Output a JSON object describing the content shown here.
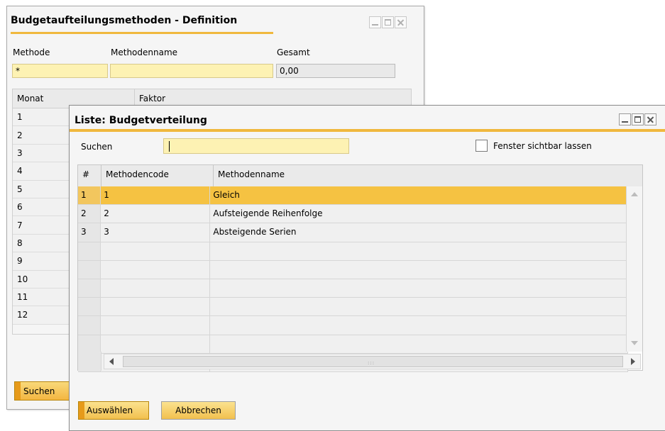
{
  "back_window": {
    "title": "Budgetaufteilungsmethoden - Definition",
    "fields": {
      "method_label": "Methode",
      "method_value": "*",
      "method_name_label": "Methodenname",
      "method_name_value": "",
      "total_label": "Gesamt",
      "total_value": "0,00"
    },
    "table": {
      "columns": [
        "Monat",
        "Faktor"
      ],
      "rows": [
        "1",
        "2",
        "3",
        "4",
        "5",
        "6",
        "7",
        "8",
        "9",
        "10",
        "11",
        "12"
      ]
    },
    "search_button": "Suchen"
  },
  "dialog": {
    "title": "Liste: Budgetverteilung",
    "search_label": "Suchen",
    "search_value": "",
    "keep_visible_label": "Fenster sichtbar lassen",
    "keep_visible_checked": false,
    "table": {
      "columns": [
        "#",
        "Methodencode",
        "Methodenname"
      ],
      "rows": [
        {
          "num": "1",
          "code": "1",
          "name": "Gleich",
          "selected": true
        },
        {
          "num": "2",
          "code": "2",
          "name": "Aufsteigende Reihenfolge",
          "selected": false
        },
        {
          "num": "3",
          "code": "3",
          "name": "Absteigende Serien",
          "selected": false
        }
      ],
      "empty_rows": 7
    },
    "buttons": {
      "choose": "Auswählen",
      "cancel": "Abbrechen"
    }
  },
  "colors": {
    "accent": "#f0b83d",
    "selection": "#f5c242",
    "input_yellow": "#fdf2b3"
  },
  "icons": [
    "minimize-icon",
    "maximize-icon",
    "close-icon",
    "scroll-up-icon",
    "scroll-down-icon",
    "scroll-left-icon",
    "scroll-right-icon",
    "grip-icon"
  ]
}
